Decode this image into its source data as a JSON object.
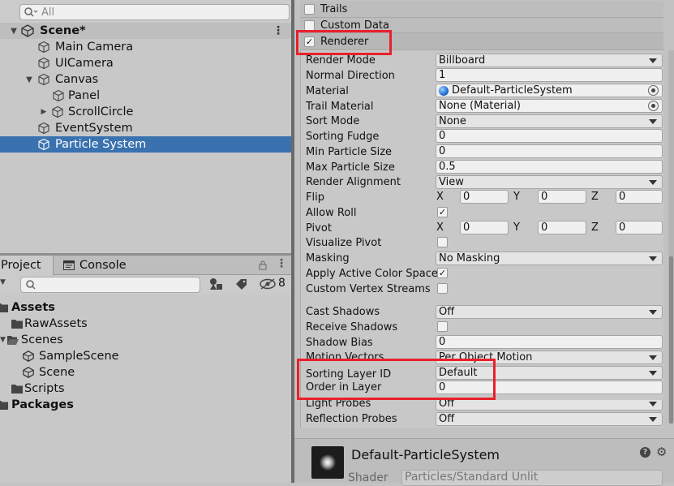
{
  "hierarchy": {
    "search_placeholder": "All",
    "items": [
      {
        "label": "Scene*",
        "type": "scene"
      },
      {
        "label": "Main Camera"
      },
      {
        "label": "UICamera"
      },
      {
        "label": "Canvas"
      },
      {
        "label": "Panel"
      },
      {
        "label": "ScrollCircle"
      },
      {
        "label": "EventSystem"
      },
      {
        "label": "Particle System",
        "selected": true
      }
    ]
  },
  "project": {
    "tabs": [
      "Project",
      "Console"
    ],
    "hidden_count": "8",
    "items": [
      {
        "label": "Assets",
        "bold": true
      },
      {
        "label": "RawAssets"
      },
      {
        "label": "Scenes"
      },
      {
        "label": "SampleScene"
      },
      {
        "label": "Scene"
      },
      {
        "label": "Scripts"
      },
      {
        "label": "Packages",
        "bold": true
      }
    ]
  },
  "inspector": {
    "modules": [
      {
        "label": "Trails",
        "checked": false
      },
      {
        "label": "Custom Data",
        "checked": false
      },
      {
        "label": "Renderer",
        "checked": true
      }
    ],
    "properties": {
      "render_mode": {
        "label": "Render Mode",
        "value": "Billboard"
      },
      "normal_direction": {
        "label": "Normal Direction",
        "value": "1"
      },
      "material": {
        "label": "Material",
        "value": "Default-ParticleSystem"
      },
      "trail_material": {
        "label": "Trail Material",
        "value": "None (Material)"
      },
      "sort_mode": {
        "label": "Sort Mode",
        "value": "None"
      },
      "sorting_fudge": {
        "label": "Sorting Fudge",
        "value": "0"
      },
      "min_particle_size": {
        "label": "Min Particle Size",
        "value": "0"
      },
      "max_particle_size": {
        "label": "Max Particle Size",
        "value": "0.5"
      },
      "render_alignment": {
        "label": "Render Alignment",
        "value": "View"
      },
      "flip": {
        "label": "Flip",
        "x": "0",
        "y": "0",
        "z": "0"
      },
      "allow_roll": {
        "label": "Allow Roll",
        "checked": true
      },
      "pivot": {
        "label": "Pivot",
        "x": "0",
        "y": "0",
        "z": "0"
      },
      "visualize_pivot": {
        "label": "Visualize Pivot",
        "checked": false
      },
      "masking": {
        "label": "Masking",
        "value": "No Masking"
      },
      "apply_active_color_space": {
        "label": "Apply Active Color Space",
        "checked": true
      },
      "custom_vertex_streams": {
        "label": "Custom Vertex Streams",
        "checked": false
      },
      "cast_shadows": {
        "label": "Cast Shadows",
        "value": "Off"
      },
      "receive_shadows": {
        "label": "Receive Shadows",
        "checked": false
      },
      "shadow_bias": {
        "label": "Shadow Bias",
        "value": "0"
      },
      "motion_vectors": {
        "label": "Motion Vectors",
        "value": "Per Object Motion"
      },
      "sorting_layer_id": {
        "label": "Sorting Layer ID",
        "value": "Default"
      },
      "order_in_layer": {
        "label": "Order in Layer",
        "value": "0"
      },
      "light_probes": {
        "label": "Light Probes",
        "value": "Off"
      },
      "reflection_probes": {
        "label": "Reflection Probes",
        "value": "Off"
      }
    },
    "axis_labels": {
      "x": "X",
      "y": "Y",
      "z": "Z"
    },
    "material_panel": {
      "name": "Default-ParticleSystem",
      "shader_label": "Shader",
      "shader_value": "Particles/Standard Unlit"
    }
  },
  "colors": {
    "selection": "#3a72b0",
    "highlight_box": "#e8212a",
    "panel_bg": "#c2c2c2"
  }
}
